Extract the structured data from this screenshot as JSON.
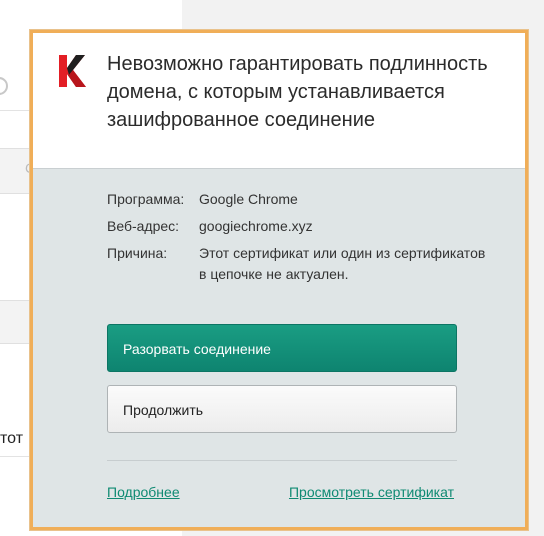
{
  "background": {
    "fragment_text": "тот",
    "fragment_char": "С"
  },
  "dialog": {
    "title": "Невозможно гарантировать подлинность домена, с которым устанавливается зашифрованное соединение",
    "rows": [
      {
        "label": "Программа:",
        "value": "Google Chrome"
      },
      {
        "label": "Веб-адрес:",
        "value": "googiechrome.xyz"
      },
      {
        "label": "Причина:",
        "value": "Этот сертификат или один из сертификатов в цепочке не актуален."
      }
    ],
    "primary_button": "Разорвать соединение",
    "secondary_button": "Продолжить",
    "link_more": "Подробнее",
    "link_cert": "Просмотреть сертификат",
    "colors": {
      "accent_border": "#f0ae58",
      "primary": "#128f78",
      "link": "#0f8a73",
      "logo_red": "#e31e25"
    },
    "logo_icon": "kaspersky-k-logo"
  }
}
